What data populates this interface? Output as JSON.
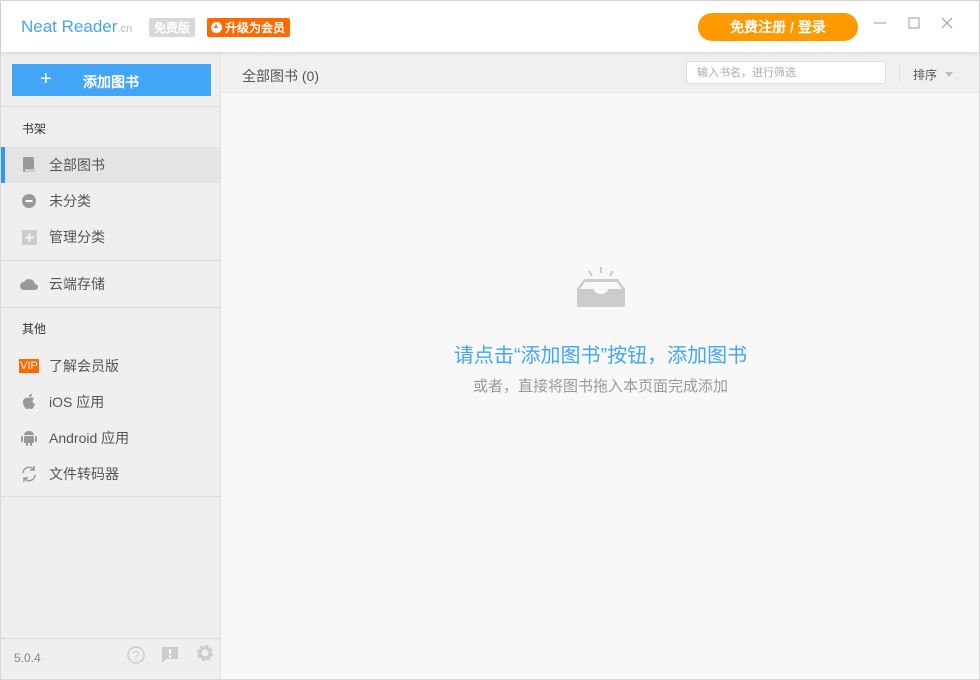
{
  "app": {
    "name": "Neat Reader",
    "suffix": ".cn",
    "free_badge": "免费版",
    "upgrade_badge": "升级为会员",
    "login": "免费注册 / 登录",
    "version": "5.0.4"
  },
  "sidebar": {
    "add_button": "添加图书",
    "add_icon": "+",
    "bookshelf_title": "书架",
    "shelf_items": [
      {
        "label": "全部图书",
        "icon": "book-icon"
      },
      {
        "label": "未分类",
        "icon": "minus-circle-icon"
      },
      {
        "label": "管理分类",
        "icon": "plus-square-icon"
      }
    ],
    "cloud": {
      "label": "云端存储",
      "icon": "cloud-icon"
    },
    "other_title": "其他",
    "vip_badge": "VIP",
    "other_items": [
      {
        "label": "了解会员版",
        "icon": "vip-icon"
      },
      {
        "label": "iOS 应用",
        "icon": "apple-icon"
      },
      {
        "label": "Android 应用",
        "icon": "android-icon"
      },
      {
        "label": "文件转码器",
        "icon": "refresh-icon"
      }
    ]
  },
  "main": {
    "title": "全部图书 (0)",
    "search_placeholder": "输入书名，进行筛选",
    "sort": "排序",
    "empty_title": "请点击“添加图书”按钮，添加图书",
    "empty_sub": "或者，直接将图书拖入本页面完成添加"
  },
  "colors": {
    "accent": "#42a5f5",
    "orange": "#ff9900",
    "upgrade": "#ff6a00"
  }
}
